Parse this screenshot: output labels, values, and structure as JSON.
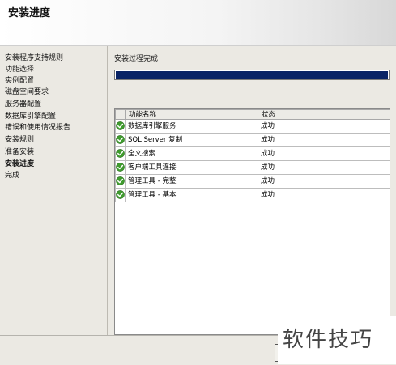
{
  "header": {
    "title": "安装进度"
  },
  "sidebar": {
    "items": [
      {
        "label": "安装程序支持规则",
        "active": false
      },
      {
        "label": "功能选择",
        "active": false
      },
      {
        "label": "实例配置",
        "active": false
      },
      {
        "label": "磁盘空间要求",
        "active": false
      },
      {
        "label": "服务器配置",
        "active": false
      },
      {
        "label": "数据库引擎配置",
        "active": false
      },
      {
        "label": "错误和使用情况报告",
        "active": false
      },
      {
        "label": "安装规则",
        "active": false
      },
      {
        "label": "准备安装",
        "active": false
      },
      {
        "label": "安装进度",
        "active": true
      },
      {
        "label": "完成",
        "active": false
      }
    ]
  },
  "main": {
    "status_text": "安装过程完成",
    "progress": {
      "percent": 100,
      "color": "#0a2466"
    },
    "table": {
      "columns": [
        "功能名称",
        "状态"
      ],
      "rows": [
        {
          "icon": "green-check-icon",
          "name": "数据库引擎服务",
          "status": "成功"
        },
        {
          "icon": "green-check-icon",
          "name": "SQL Server 复制",
          "status": "成功"
        },
        {
          "icon": "green-check-icon",
          "name": "全文搜索",
          "status": "成功"
        },
        {
          "icon": "green-check-icon",
          "name": "客户端工具连接",
          "status": "成功"
        },
        {
          "icon": "green-check-icon",
          "name": "管理工具 - 完整",
          "status": "成功"
        },
        {
          "icon": "green-check-icon",
          "name": "管理工具 - 基本",
          "status": "成功"
        }
      ]
    }
  },
  "watermark": {
    "text": "软件技巧"
  }
}
